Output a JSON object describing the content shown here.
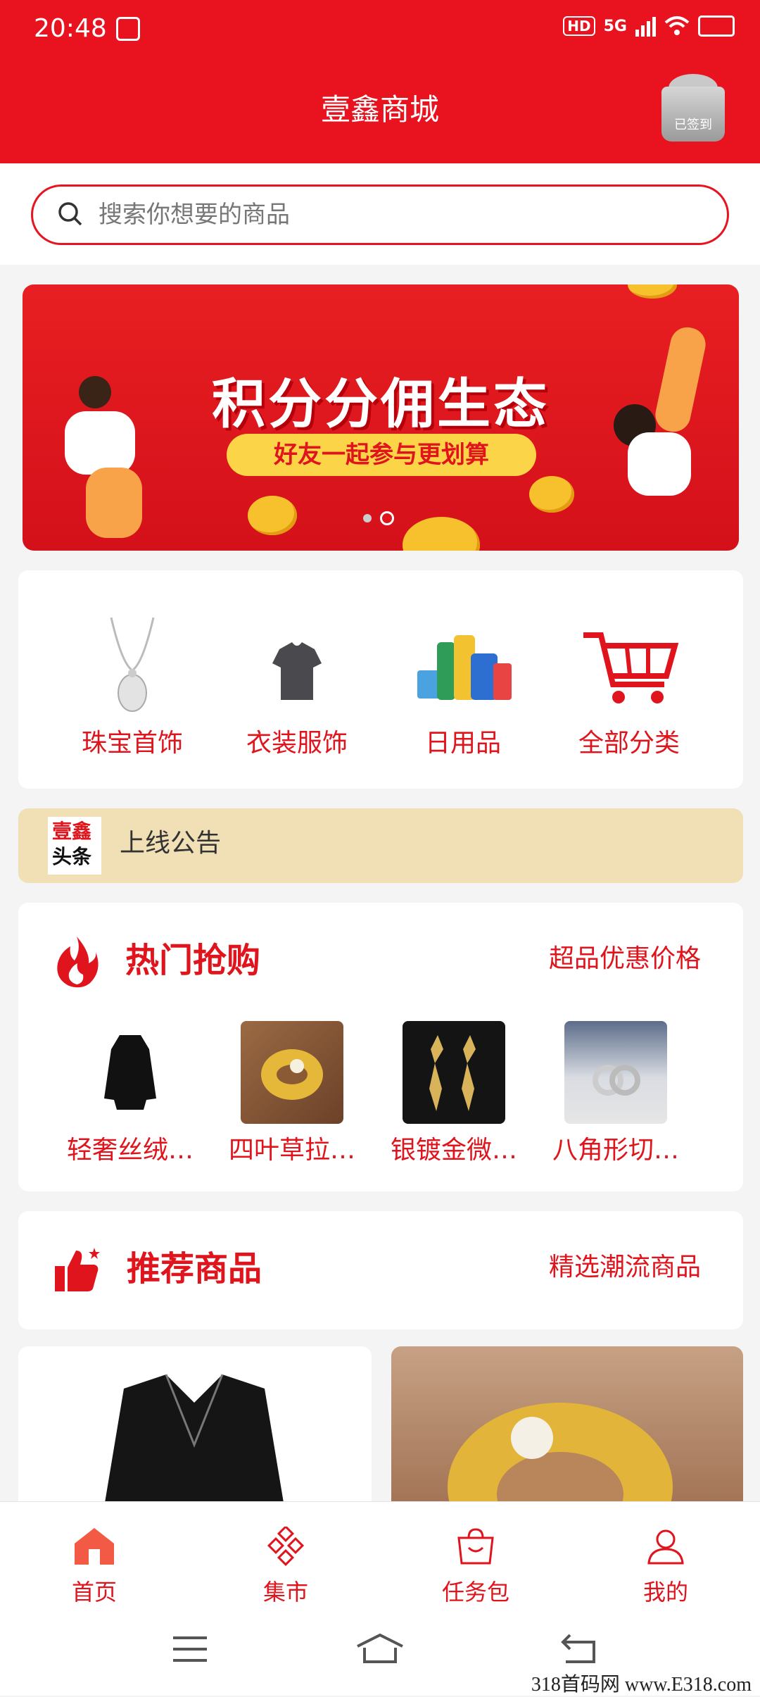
{
  "status_bar": {
    "time": "20:48",
    "hd": "HD",
    "network": "5G"
  },
  "header": {
    "title": "壹鑫商城",
    "signin_label": "已签到"
  },
  "search": {
    "placeholder": "搜索你想要的商品"
  },
  "banner": {
    "title": "积分分佣生态",
    "subtitle": "好友一起参与更划算",
    "active_dot": 2,
    "dot_count": 2
  },
  "categories": [
    {
      "label": "珠宝首饰",
      "icon": "necklace-icon"
    },
    {
      "label": "衣装服饰",
      "icon": "tshirt-icon"
    },
    {
      "label": "日用品",
      "icon": "daily-goods-icon"
    },
    {
      "label": "全部分类",
      "icon": "cart-icon"
    }
  ],
  "notice": {
    "logo_line1": "壹鑫",
    "logo_line2": "头条",
    "text": "上线公告"
  },
  "hot": {
    "title": "热门抢购",
    "subtitle": "超品优惠价格",
    "items": [
      {
        "label": "轻奢丝绒…"
      },
      {
        "label": "四叶草拉…"
      },
      {
        "label": "银镀金微…"
      },
      {
        "label": "八角形切…"
      }
    ]
  },
  "recommend": {
    "title": "推荐商品",
    "subtitle": "精选潮流商品"
  },
  "bottom_nav": [
    {
      "label": "首页",
      "icon": "home-icon",
      "active": true
    },
    {
      "label": "集市",
      "icon": "market-icon"
    },
    {
      "label": "任务包",
      "icon": "bag-icon"
    },
    {
      "label": "我的",
      "icon": "user-icon"
    }
  ],
  "watermark": "318首码网 www.E318.com",
  "colors": {
    "brand": "#e8131f",
    "notice_bg": "#f1dfb5"
  }
}
